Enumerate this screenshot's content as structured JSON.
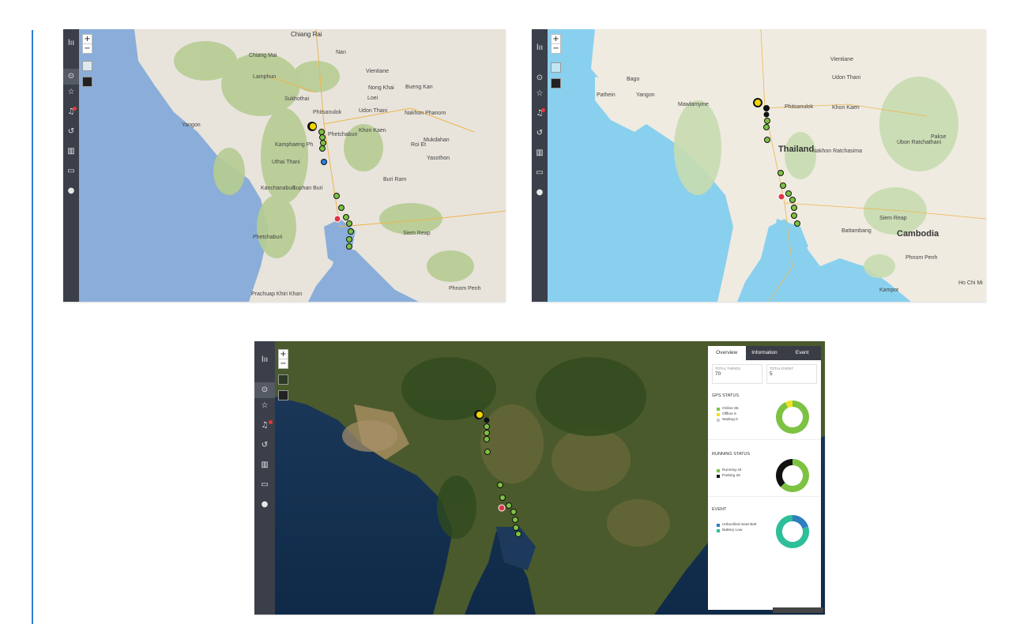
{
  "panels": {
    "top_left": {
      "labels": {
        "chiang_rai": "Chiang Rai",
        "chiang_mai": "Chiang Mai",
        "nan": "Nan",
        "lamphun": "Lamphun",
        "loei": "Loei",
        "sukhothai": "Sukhothai",
        "phitsanulok": "Phitsanulok",
        "vientiane": "Vientiane",
        "nong_khai": "Nong Khai",
        "bueng_kan": "Bueng Kan",
        "udon_thani": "Udon Thani",
        "nakhon_phanom": "Nakhon Phanom",
        "yangon": "Yangon",
        "kamphaeng": "Kamphaeng Ph",
        "phetchabun": "Phetchabun",
        "khon_kaen": "Khon Kaen",
        "mukdahan": "Mukdahan",
        "roi_et": "Roi Et",
        "yasothon": "Yasothon",
        "uthai": "Uthai Thani",
        "kanchanaburi": "Kanchanaburi",
        "suphan": "Suphan Buri",
        "buri_ram": "Buri Ram",
        "siem_reap": "Siem Reap",
        "phetchaburi": "Phetchaburi",
        "prachuap": "Prachuap Khiri Khan",
        "phnom_penh": "Phnom Penh"
      }
    },
    "top_right": {
      "labels": {
        "thailand": "Thailand",
        "cambodia": "Cambodia",
        "yangon": "Yangon",
        "bago": "Bago",
        "vientiane": "Vientiane",
        "mawlamyine": "Mawlamyine",
        "udon_thani": "Udon Thani",
        "khon_kaen": "Khon Kaen",
        "battambang": "Battambang",
        "siem_reap": "Siem Reap",
        "phnom_penh": "Phnom Penh",
        "nakhon_ratchasima": "Nakhon Ratchasima",
        "pathein": "Pathein",
        "phitsanulok": "Phitsanulok",
        "ubon": "Ubon Ratchathani",
        "pakse": "Pakse",
        "kampot": "Kampot",
        "ho_chi_minh": "Ho Chi Mi"
      }
    },
    "bottom": {
      "tabs": [
        "Overview",
        "Information",
        "Event"
      ],
      "stats": {
        "total_things_label": "TOTAL THINGS",
        "total_things_value": "70",
        "total_event_label": "TOTAL EVENT",
        "total_event_value": "5"
      },
      "gps": {
        "title": "GPS STATUS",
        "items": [
          {
            "label": "Online 65",
            "color": "#7dc242",
            "value": 65
          },
          {
            "label": "Offline 5",
            "color": "#f2e222",
            "value": 5
          },
          {
            "label": "Waiting 0",
            "color": "#cccccc",
            "value": 0
          }
        ]
      },
      "running": {
        "title": "RUNNING STATUS",
        "items": [
          {
            "label": "Running 44",
            "color": "#7dc242",
            "value": 44
          },
          {
            "label": "Parking 26",
            "color": "#111111",
            "value": 26
          }
        ]
      },
      "event": {
        "title": "EVENT",
        "items": [
          {
            "label": "Unbuckled Seat Belt",
            "color": "#2f7fc1",
            "value": 1
          },
          {
            "label": "Battery Low",
            "color": "#2dbf9a",
            "value": 4
          }
        ]
      }
    }
  },
  "sidebar_icons": [
    "menu-bars-icon",
    "login-icon",
    "star-icon",
    "bell-icon",
    "history-icon",
    "chart-icon",
    "monitor-icon",
    "play-icon"
  ],
  "colors": {
    "sidebar": "#3b3f4a",
    "accent_line": "#2a7fd4",
    "marker_green": "#7dc242",
    "marker_red": "#e0344a",
    "marker_yellow": "#f2d400"
  }
}
